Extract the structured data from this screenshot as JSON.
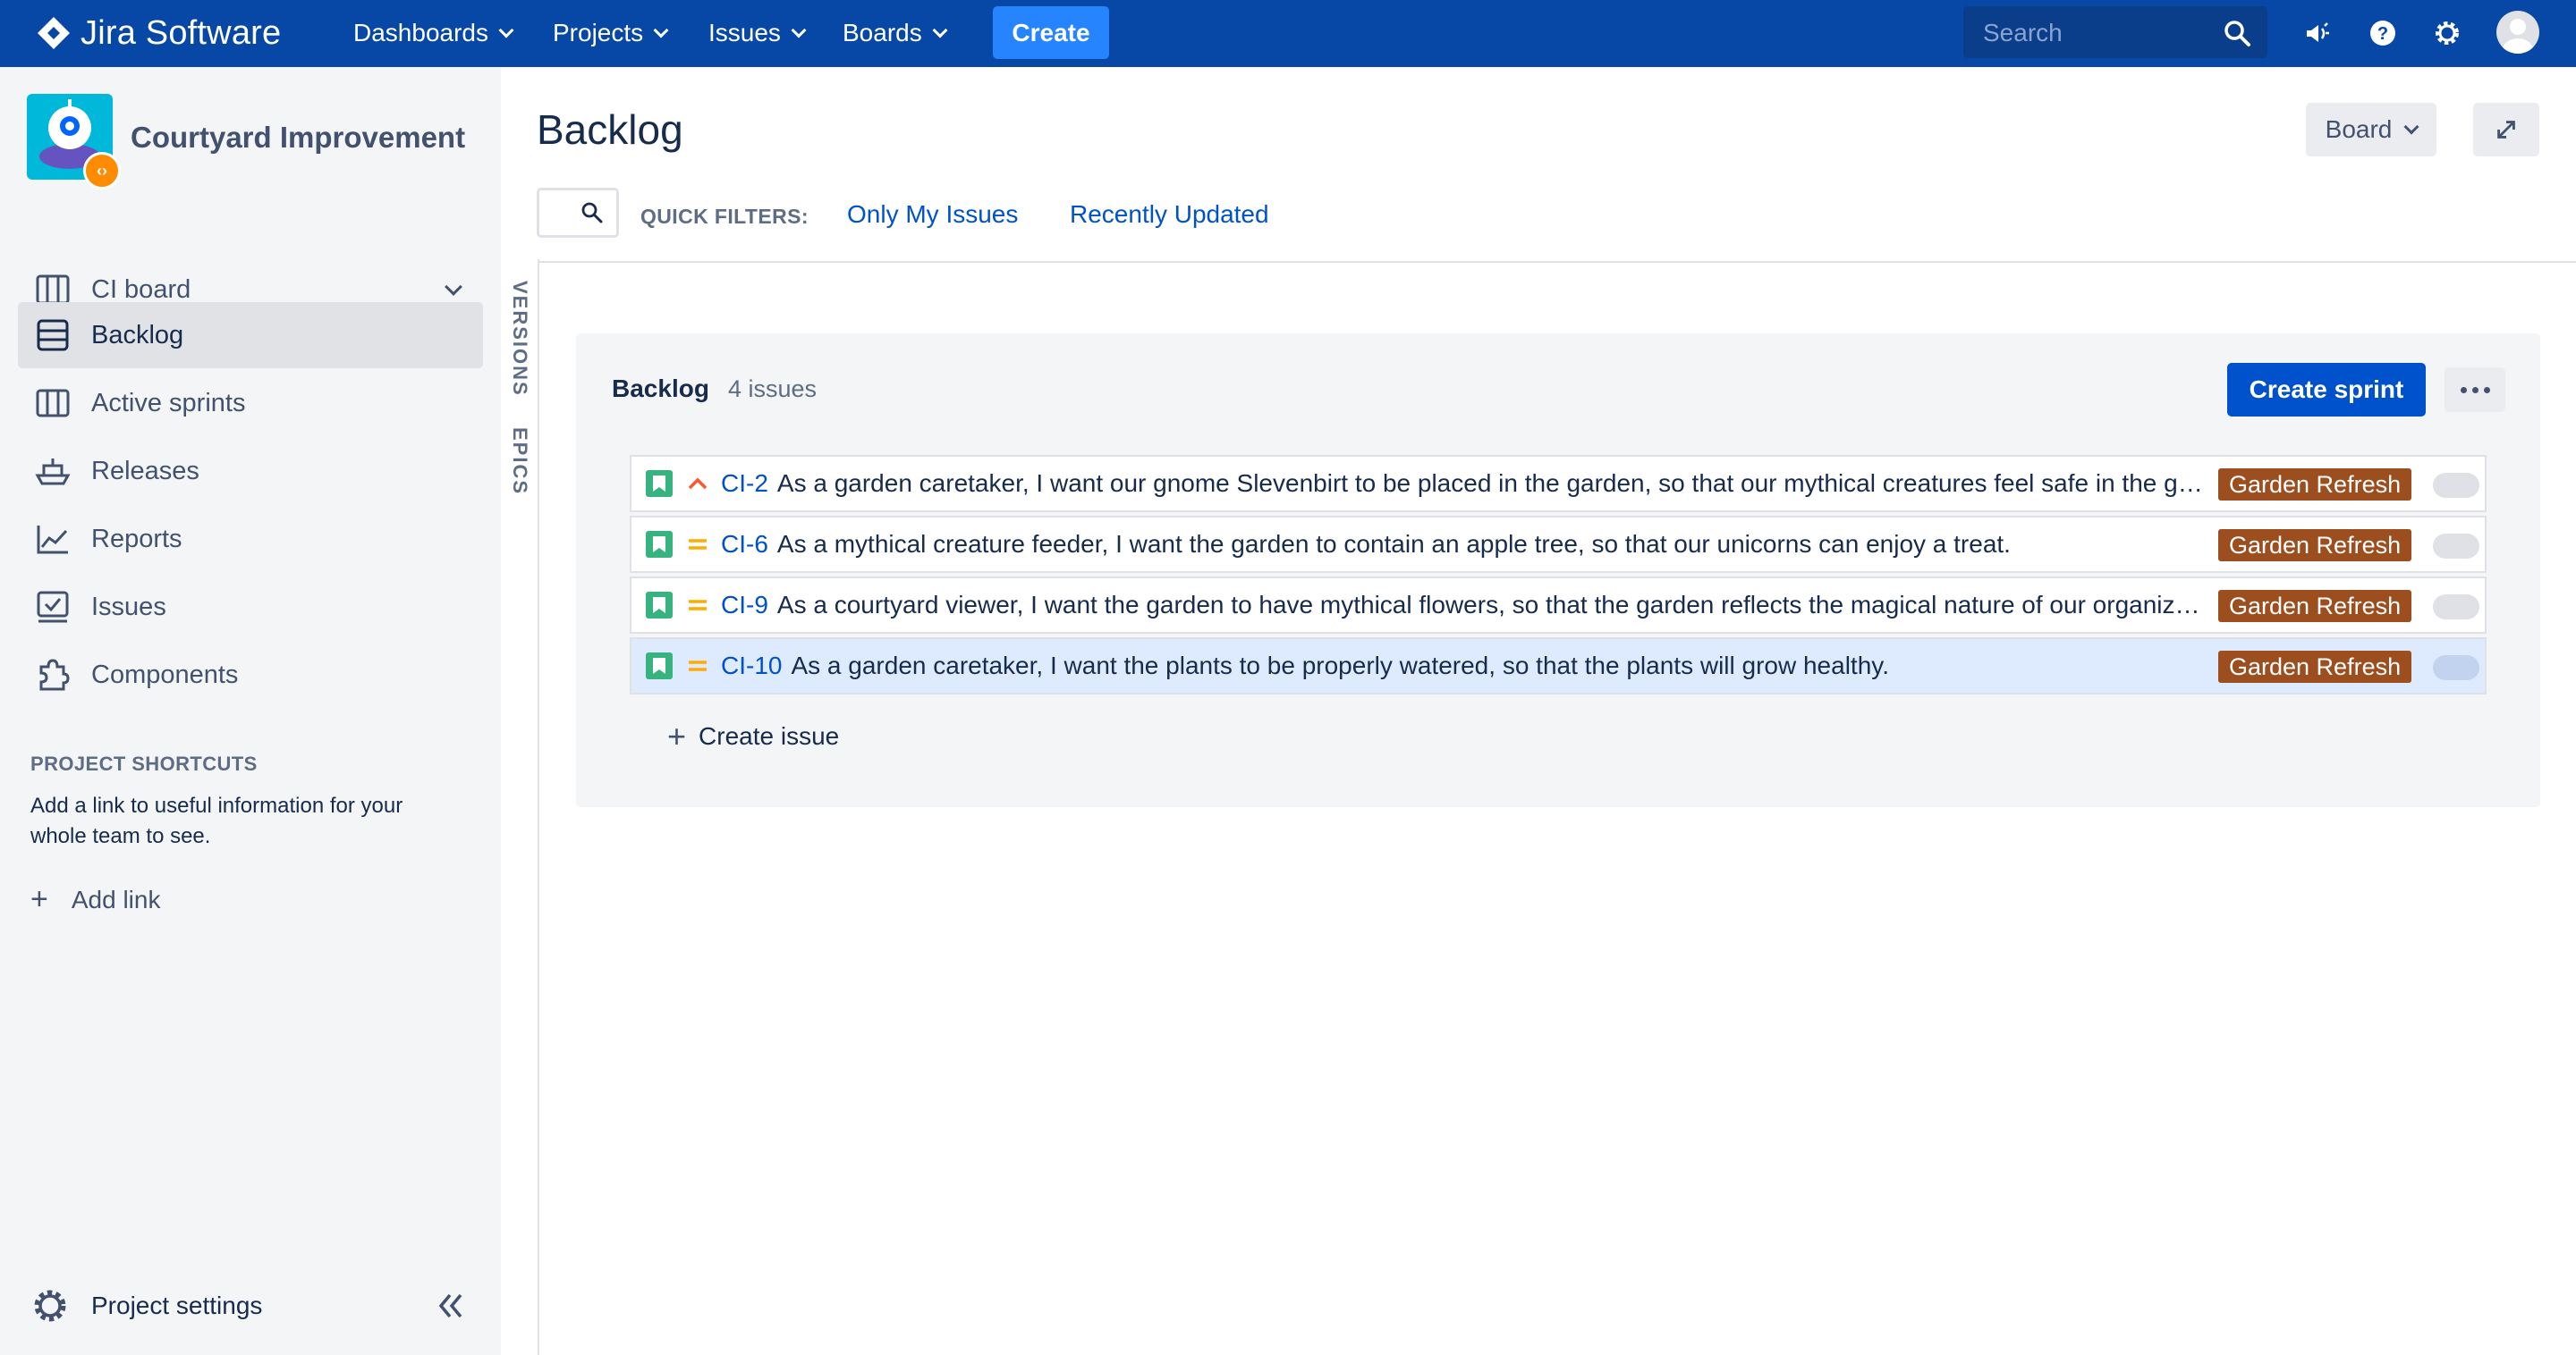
{
  "topnav": {
    "brand": "Jira Software",
    "items": [
      {
        "label": "Dashboards"
      },
      {
        "label": "Projects"
      },
      {
        "label": "Issues"
      },
      {
        "label": "Boards"
      }
    ],
    "create_label": "Create",
    "search_placeholder": "Search",
    "colors": {
      "bar": "#0747a6",
      "create": "#2684ff"
    },
    "icons": [
      "megaphone-icon",
      "help-icon",
      "settings-icon",
      "user-avatar-icon"
    ]
  },
  "sidebar": {
    "project_name": "Courtyard Improvement",
    "board_switcher": "CI board",
    "items": [
      {
        "label": "Backlog",
        "icon": "backlog-icon",
        "active": true
      },
      {
        "label": "Active sprints",
        "icon": "board-columns-icon"
      },
      {
        "label": "Releases",
        "icon": "ship-icon"
      },
      {
        "label": "Reports",
        "icon": "chart-icon"
      },
      {
        "label": "Issues",
        "icon": "issues-icon"
      },
      {
        "label": "Components",
        "icon": "puzzle-icon"
      }
    ],
    "shortcuts_heading": "PROJECT SHORTCUTS",
    "shortcuts_desc": "Add a link to useful information for your whole team to see.",
    "add_link": "Add link",
    "settings": "Project settings"
  },
  "side_tabs": {
    "versions": "VERSIONS",
    "epics": "EPICS"
  },
  "header": {
    "title": "Backlog",
    "board_button": "Board",
    "quick_filters_label": "QUICK FILTERS:",
    "quick_filters": [
      "Only My Issues",
      "Recently Updated"
    ]
  },
  "backlog": {
    "title": "Backlog",
    "count": "4 issues",
    "create_sprint": "Create sprint",
    "create_issue": "Create issue",
    "issues": [
      {
        "key": "CI-2",
        "priority": "high",
        "summary": "As a garden caretaker, I want our gnome Slevenbirt to be placed in the garden, so that our mythical creatures feel safe in the garden.",
        "epic": "Garden Refresh"
      },
      {
        "key": "CI-6",
        "priority": "medium",
        "summary": "As a mythical creature feeder, I want the garden to contain an apple tree, so that our unicorns can enjoy a treat.",
        "epic": "Garden Refresh"
      },
      {
        "key": "CI-9",
        "priority": "medium",
        "summary": "As a courtyard viewer, I want the garden to have mythical flowers, so that the garden reflects the magical nature of our organization.",
        "epic": "Garden Refresh"
      },
      {
        "key": "CI-10",
        "priority": "medium",
        "summary": "As a garden caretaker, I want the plants to be properly watered, so that the plants will grow healthy.",
        "epic": "Garden Refresh",
        "selected": true
      }
    ]
  }
}
